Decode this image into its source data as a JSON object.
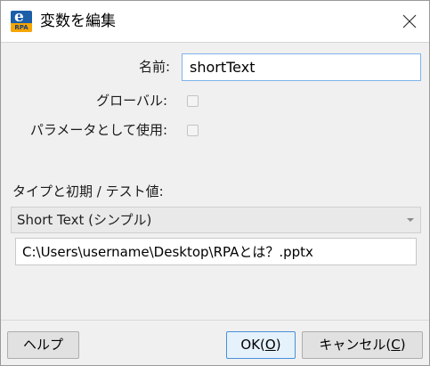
{
  "window": {
    "title": "変数を編集",
    "icon_name": "erpa-app-icon",
    "icon_letter": "e",
    "icon_subtext": "RPA"
  },
  "form": {
    "name_label": "名前:",
    "name_value": "shortText",
    "global_label": "グローバル:",
    "global_checked": false,
    "param_label": "パラメータとして使用:",
    "param_checked": false,
    "type_label": "タイプと初期 / テスト値:",
    "type_selected": "Short Text (シンプル)",
    "initial_value": "C:\\Users\\username\\Desktop\\RPAとは？.pptx"
  },
  "buttons": {
    "help": "ヘルプ",
    "ok_text": "OK(",
    "ok_key": "O",
    "ok_end": ")",
    "cancel_text": "キャンセル(",
    "cancel_key": "C",
    "cancel_end": ")"
  }
}
